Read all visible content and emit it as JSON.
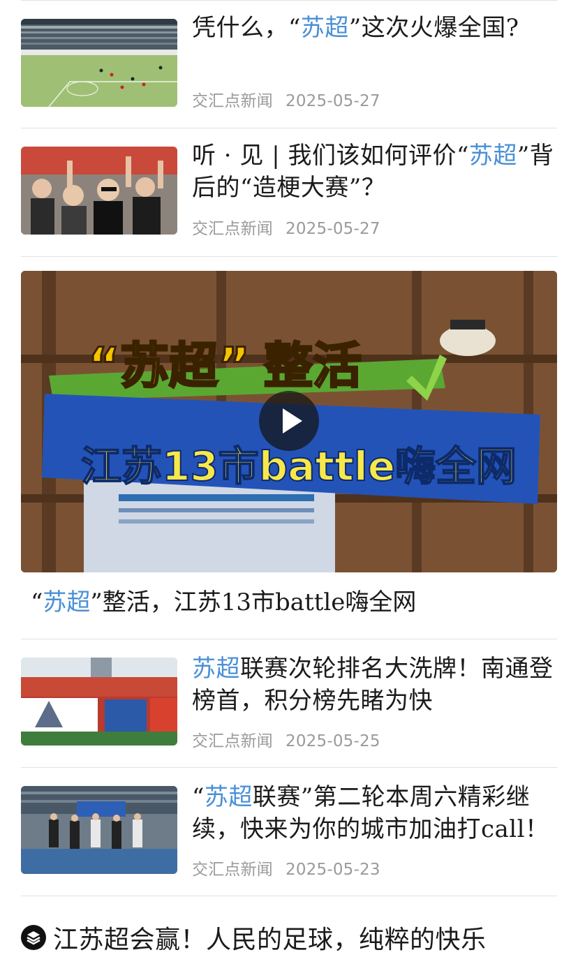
{
  "articles": [
    {
      "title_pre": "凭什么，“",
      "title_hl": "苏超",
      "title_post": "”这次火爆全国?",
      "source": "交汇点新闻",
      "date": "2025-05-27",
      "thumb": "stadium-match-aerial-image"
    },
    {
      "title_pre": "听 · 见 | 我们该如何评价“",
      "title_hl": "苏超",
      "title_post": "”背后的“造梗大赛”？",
      "source": "交汇点新闻",
      "date": "2025-05-27",
      "thumb": "cheering-fans-image"
    },
    {
      "title_pre": "",
      "title_hl": "苏超",
      "title_post": "联赛次轮排名大洗牌！南通登榜首，积分榜先睹为快",
      "source": "交汇点新闻",
      "date": "2025-05-25",
      "thumb": "stadium-banners-image"
    },
    {
      "title_pre": "“",
      "title_hl": "苏超",
      "title_post": "联赛”第二轮本周六精彩继续，快来为你的城市加油打call！",
      "source": "交汇点新闻",
      "date": "2025-05-23",
      "thumb": "players-walkout-image"
    }
  ],
  "video": {
    "overlay_line1_quote_open": "“",
    "overlay_line1_hl": "苏超",
    "overlay_line1_quote_close": "”",
    "overlay_line1_rest": "整活",
    "overlay_line2": "江苏13市battle嗨全网",
    "caption_pre": "“",
    "caption_hl": "苏超",
    "caption_post": "”整活，江苏13市battle嗨全网",
    "play_icon": "play-icon"
  },
  "bottom": {
    "icon": "layers-icon",
    "title": "江苏超会赢！人民的足球，纯粹的快乐"
  },
  "colors": {
    "highlight": "#4a90d6",
    "meta": "#9a9a9a",
    "text": "#1b1b1b",
    "divider": "#e2e2e2"
  }
}
